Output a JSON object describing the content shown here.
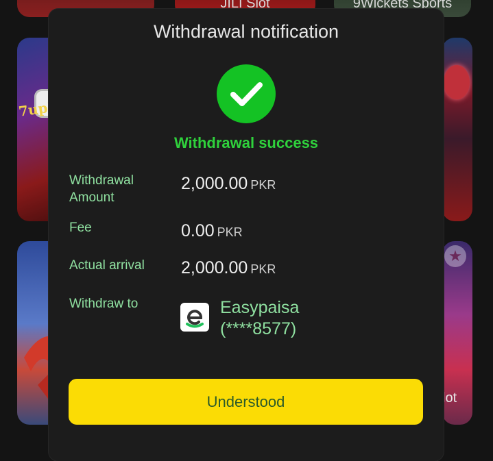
{
  "background": {
    "tile_top_middle_label": "JILI Slot",
    "tile_top_right_label": "9Wickets Sports",
    "tile_left_label": "7up7",
    "tile_bottom_right_label": "lot",
    "favorite_icon": "star-icon"
  },
  "modal": {
    "title": "Withdrawal notification",
    "status_icon": "check-icon",
    "status_text": "Withdrawal success",
    "rows": [
      {
        "label": "Withdrawal Amount",
        "value": "2,000.00",
        "unit": "PKR"
      },
      {
        "label": "Fee",
        "value": "0.00",
        "unit": "PKR"
      },
      {
        "label": "Actual arrival",
        "value": "2,000.00",
        "unit": "PKR"
      }
    ],
    "withdraw_to": {
      "label": "Withdraw to",
      "wallet_icon": "easypaisa-logo-icon",
      "wallet_name": "Easypaisa",
      "account": "(****8577)"
    },
    "button_label": "Understood"
  },
  "colors": {
    "accent_yellow": "#fbdc05",
    "success_green": "#14c224",
    "label_green": "#8fe0a0"
  }
}
